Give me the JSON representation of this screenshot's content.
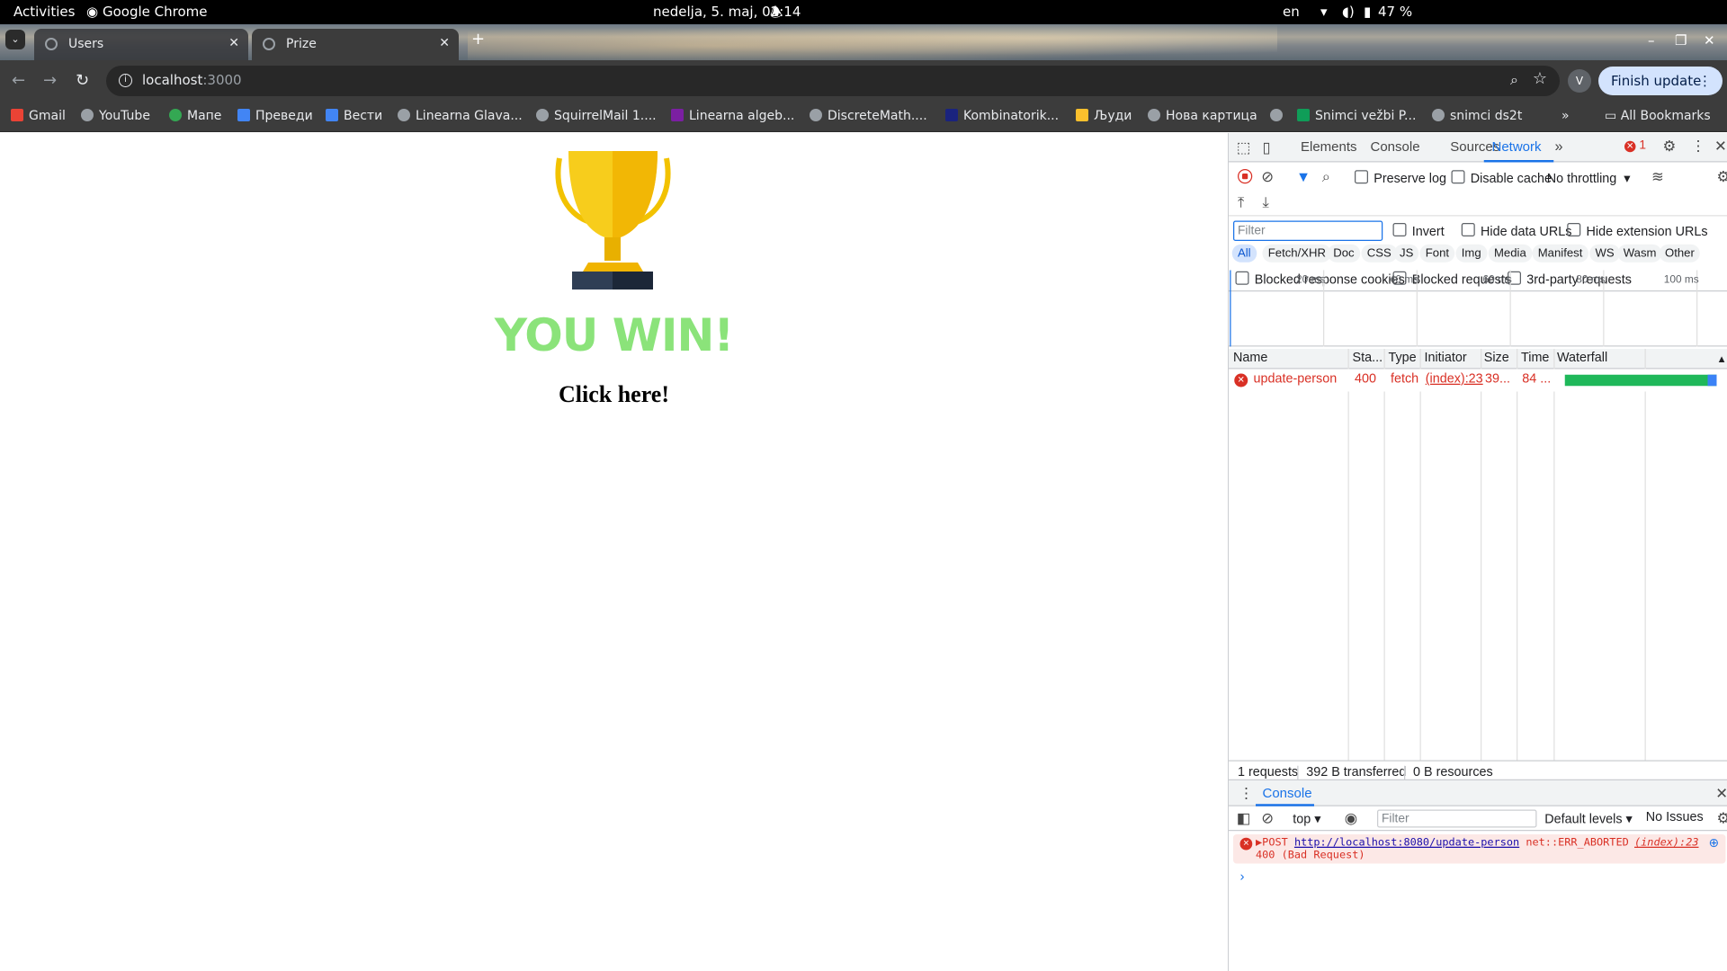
{
  "system_bar": {
    "activities": "Activities",
    "app_name": "Google Chrome",
    "datetime": "nedelja,  5. maj, 02:14",
    "language": "en",
    "battery": "47 %"
  },
  "browser": {
    "tabs": [
      {
        "title": "Users",
        "active": false
      },
      {
        "title": "Prize",
        "active": true
      }
    ],
    "url_host": "localhost",
    "url_port": ":3000",
    "profile_initial": "V",
    "finish_update": "Finish update",
    "bookmarks": [
      "Gmail",
      "YouTube",
      "Мапе",
      "Преведи",
      "Вести",
      "Linearna Glava...",
      "SquirrelMail 1....",
      "Linearna algeb...",
      "DiscreteMath....",
      "Kombinatorik...",
      "Људи",
      "Нова картица",
      "",
      "Snimci vežbi P...",
      "snimci ds2t"
    ],
    "all_bookmarks": "All Bookmarks"
  },
  "page": {
    "headline": "YOU WIN!",
    "link_text": "Click here!",
    "headline_color": "#8be37a"
  },
  "devtools": {
    "tabs": [
      "Elements",
      "Console",
      "Sources",
      "Network"
    ],
    "active_tab": "Network",
    "error_count": "1",
    "toolbar": {
      "preserve_log": "Preserve log",
      "disable_cache": "Disable cache",
      "throttling": "No throttling"
    },
    "filter": {
      "placeholder": "Filter",
      "invert": "Invert",
      "hide_data_urls": "Hide data URLs",
      "hide_extension_urls": "Hide extension URLs"
    },
    "types": [
      "All",
      "Fetch/XHR",
      "Doc",
      "CSS",
      "JS",
      "Font",
      "Img",
      "Media",
      "Manifest",
      "WS",
      "Wasm",
      "Other"
    ],
    "blocked": {
      "response_cookies": "Blocked response cookies",
      "requests": "Blocked requests",
      "third_party": "3rd-party requests"
    },
    "timeline_ticks": [
      "20 ms",
      "40 ms",
      "60 ms",
      "80 ms",
      "100 ms"
    ],
    "columns": [
      "Name",
      "Sta...",
      "Type",
      "Initiator",
      "Size",
      "Time",
      "Waterfall"
    ],
    "requests": [
      {
        "name": "update-person",
        "status": "400",
        "type": "fetch",
        "initiator": "(index):23",
        "size": "39...",
        "time": "84 ..."
      }
    ],
    "status": {
      "requests": "1 requests",
      "transferred": "392 B transferred",
      "resources": "0 B resources"
    },
    "console": {
      "title": "Console",
      "context": "top",
      "filter_placeholder": "Filter",
      "levels": "Default levels",
      "issues": "No Issues",
      "message_method": "POST",
      "message_url": "http://localhost:8080/update-person",
      "message_error": "net::ERR_ABORTED",
      "message_line2": "400 (Bad Request)",
      "message_source": "(index):23"
    }
  }
}
